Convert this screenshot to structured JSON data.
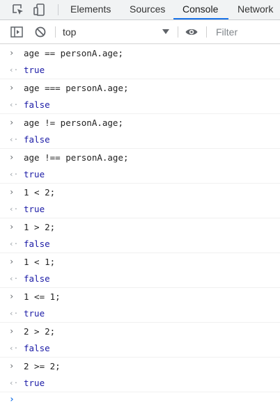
{
  "tabs": [
    {
      "label": "Elements",
      "active": false
    },
    {
      "label": "Sources",
      "active": false
    },
    {
      "label": "Console",
      "active": true
    },
    {
      "label": "Network",
      "active": false
    }
  ],
  "toolbar": {
    "context": "top",
    "filter_placeholder": "Filter"
  },
  "console": {
    "entries": [
      {
        "type": "input",
        "marker": "›",
        "text": "age == personA.age;"
      },
      {
        "type": "result",
        "marker": "‹·",
        "text": "true"
      },
      {
        "type": "input",
        "marker": "›",
        "text": "age === personA.age;"
      },
      {
        "type": "result",
        "marker": "‹·",
        "text": "false"
      },
      {
        "type": "input",
        "marker": "›",
        "text": "age != personA.age;"
      },
      {
        "type": "result",
        "marker": "‹·",
        "text": "false"
      },
      {
        "type": "input",
        "marker": "›",
        "text": "age !== personA.age;"
      },
      {
        "type": "result",
        "marker": "‹·",
        "text": "true"
      },
      {
        "type": "input",
        "marker": "›",
        "text": "1 < 2;"
      },
      {
        "type": "result",
        "marker": "‹·",
        "text": "true"
      },
      {
        "type": "input",
        "marker": "›",
        "text": "1 > 2;"
      },
      {
        "type": "result",
        "marker": "‹·",
        "text": "false"
      },
      {
        "type": "input",
        "marker": "›",
        "text": "1 < 1;"
      },
      {
        "type": "result",
        "marker": "‹·",
        "text": "false"
      },
      {
        "type": "input",
        "marker": "›",
        "text": "1 <= 1;"
      },
      {
        "type": "result",
        "marker": "‹·",
        "text": "true"
      },
      {
        "type": "input",
        "marker": "›",
        "text": "2 > 2;"
      },
      {
        "type": "result",
        "marker": "‹·",
        "text": "false"
      },
      {
        "type": "input",
        "marker": "›",
        "text": "2 >= 2;"
      },
      {
        "type": "result",
        "marker": "‹·",
        "text": "true"
      }
    ],
    "prompt_marker": "›"
  },
  "colors": {
    "accent": "#1a73e8",
    "result_text": "#1a1aa6",
    "input_text": "#222222"
  }
}
